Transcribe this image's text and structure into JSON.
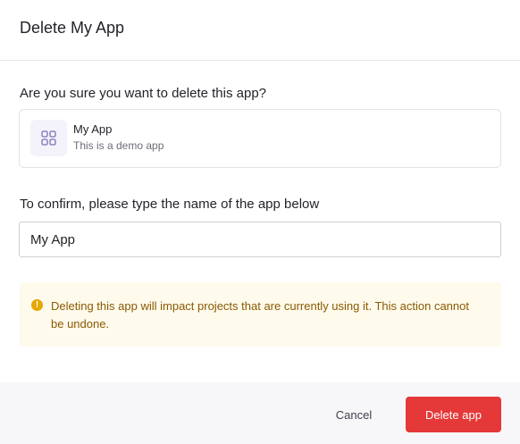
{
  "dialog": {
    "title": "Delete My App",
    "question": "Are you sure you want to delete this app?",
    "app": {
      "icon": "grid-icon",
      "name": "My App",
      "description": "This is a demo app"
    },
    "confirm": {
      "label": "To confirm, please type the name of the app below",
      "value": "My App"
    },
    "warning": {
      "icon": "warning-icon",
      "text": "Deleting this app will impact projects that are currently using it. This action cannot be undone."
    },
    "footer": {
      "cancel_label": "Cancel",
      "delete_label": "Delete app"
    }
  },
  "colors": {
    "danger": "#e53838",
    "warning_bg": "#fefaec",
    "warning_text": "#8a5a00",
    "warning_icon": "#e7a600",
    "app_icon": "#7e6fb8",
    "app_icon_bg": "#f4f3fb"
  }
}
